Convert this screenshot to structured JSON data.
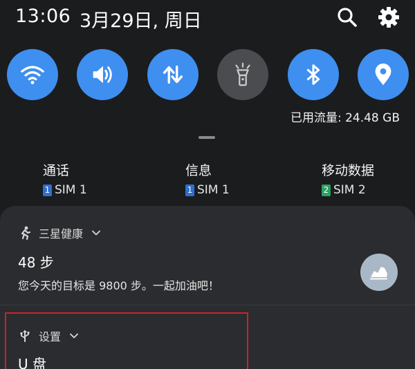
{
  "status": {
    "time": "13:06",
    "date": "3月29日, 周日"
  },
  "quick_toggles": [
    {
      "icon": "wifi-icon",
      "state": "on"
    },
    {
      "icon": "sound-icon",
      "state": "on"
    },
    {
      "icon": "mobile-data-icon",
      "state": "on"
    },
    {
      "icon": "flashlight-icon",
      "state": "off"
    },
    {
      "icon": "bluetooth-icon",
      "state": "on"
    },
    {
      "icon": "location-icon",
      "state": "on"
    }
  ],
  "data_usage": "已用流量: 24.48 GB",
  "sim_shortcuts": [
    {
      "title": "通话",
      "badge": "1",
      "sim": "SIM 1"
    },
    {
      "title": "信息",
      "badge": "1",
      "sim": "SIM 1"
    },
    {
      "title": "移动数据",
      "badge": "2",
      "sim": "SIM 2"
    }
  ],
  "notifications": [
    {
      "app": "三星健康",
      "title": "48 步",
      "text": "您今天的目标是 9800 步。一起加油吧！"
    },
    {
      "app": "设置",
      "title": "U 盘"
    }
  ],
  "colors": {
    "background": "#1b1c1e",
    "card": "#2b2c2f",
    "accent": "#3e8ff0",
    "toggle_off": "#4b4c4f",
    "highlight": "#c8242e"
  }
}
